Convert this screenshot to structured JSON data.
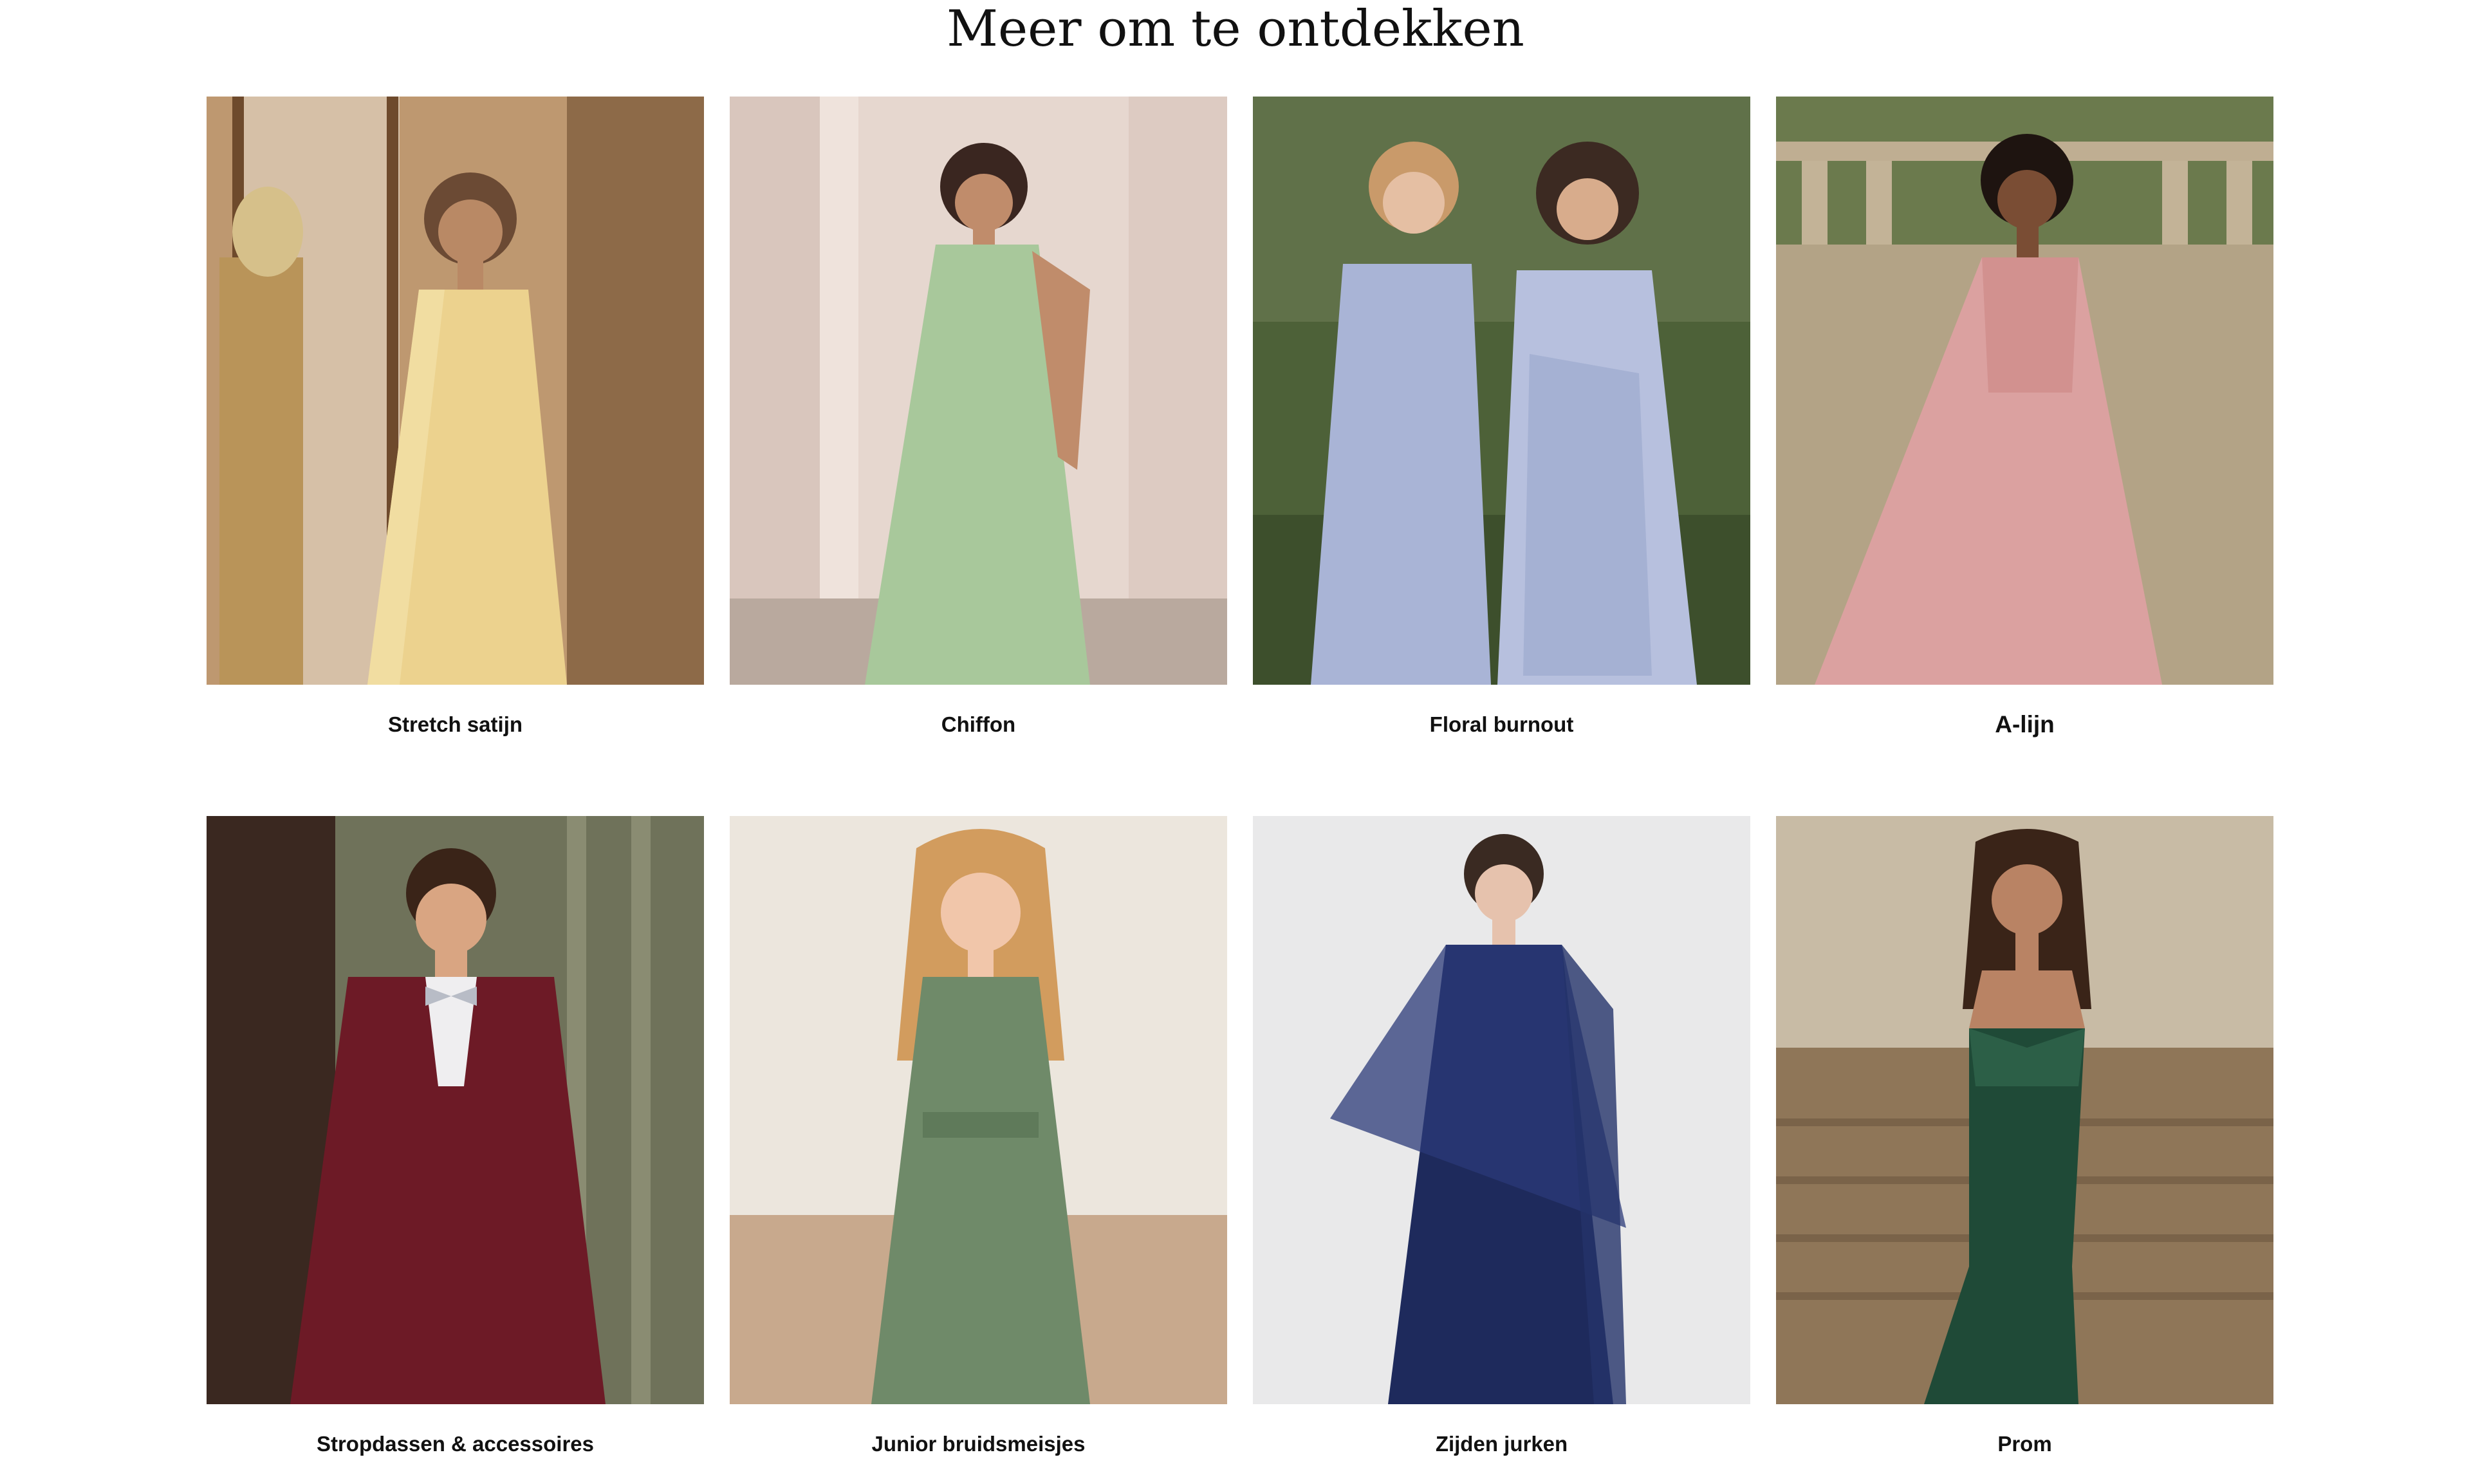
{
  "section": {
    "title": "Meer om te ontdekken"
  },
  "tiles": [
    {
      "label": "Stretch satijn",
      "image": "woman-yellow-satin-one-shoulder-gown-photo",
      "dress_color": "#ecd28e",
      "background_color": "#b58a5b"
    },
    {
      "label": "Chiffon",
      "image": "woman-sage-green-chiffon-one-shoulder-gown-photo",
      "dress_color": "#a8c89b",
      "background_color": "#e6d7cf"
    },
    {
      "label": "Floral burnout",
      "image": "two-women-periwinkle-dresses-garden-photo",
      "dress_color": "#a9b4d6",
      "background_color": "#4d6138"
    },
    {
      "label": "A-lijn",
      "image": "woman-blush-pink-a-line-chiffon-gown-photo",
      "dress_color": "#dba1a0",
      "background_color": "#a29278"
    },
    {
      "label": "Stropdassen & accessoires",
      "image": "man-burgundy-suit-grey-bow-tie-photo",
      "dress_color": "#6d1a26",
      "background_color": "#6f725a"
    },
    {
      "label": "Junior bruidsmeisjes",
      "image": "girl-sage-green-junior-bridesmaid-dress-photo",
      "dress_color": "#6f8a69",
      "background_color": "#e5ddd2"
    },
    {
      "label": "Zijden jurken",
      "image": "woman-navy-silk-dress-sheer-cape-photo",
      "dress_color": "#1e2a5c",
      "background_color": "#e9e9ea"
    },
    {
      "label": "Prom",
      "image": "woman-emerald-sequin-strapless-prom-gown-photo",
      "dress_color": "#1f4a37",
      "background_color": "#9f8a6b"
    }
  ]
}
